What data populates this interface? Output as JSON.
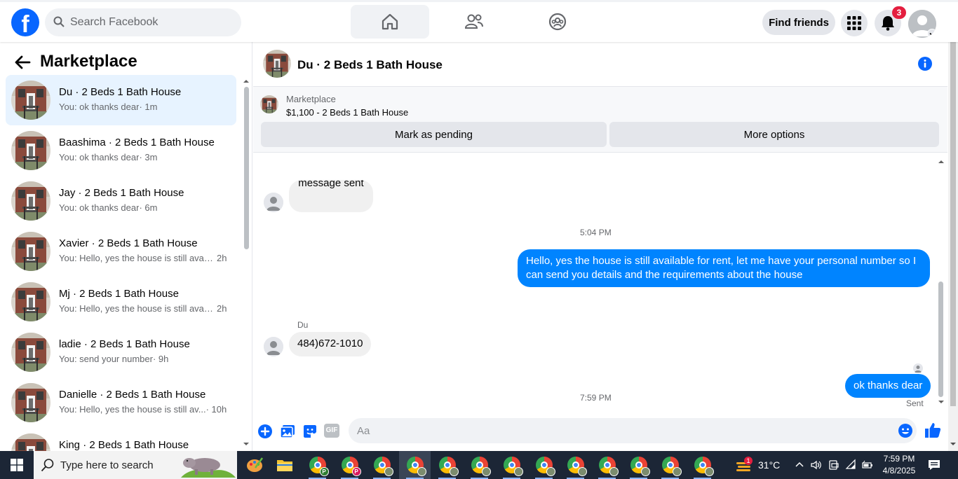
{
  "topbar": {
    "logo": "f",
    "search_placeholder": "Search Facebook",
    "find_friends": "Find friends",
    "notification_count": "3"
  },
  "sidebar": {
    "title": "Marketplace",
    "conversations": [
      {
        "name": "Du · 2 Beds 1 Bath House",
        "preview": "You: ok thanks dear",
        "time": "· 1m",
        "active": true
      },
      {
        "name": "Baashima · 2 Beds 1 Bath House",
        "preview": "You: ok thanks dear",
        "time": "· 3m"
      },
      {
        "name": "Jay · 2 Beds 1 Bath House",
        "preview": "You: ok thanks dear",
        "time": "· 6m"
      },
      {
        "name": "Xavier · 2 Beds 1 Bath House",
        "preview": "You: Hello, yes the house is still avai...",
        "time": "2h"
      },
      {
        "name": "Mj · 2 Beds 1 Bath House",
        "preview": "You: Hello, yes the house is still avai...",
        "time": "2h"
      },
      {
        "name": "ladie · 2 Beds 1 Bath House",
        "preview": "You: send your number",
        "time": "· 9h"
      },
      {
        "name": "Danielle · 2 Beds 1 Bath House",
        "preview": "You: Hello, yes the house is still av...",
        "time": "· 10h"
      },
      {
        "name": "King · 2 Beds 1 Bath House",
        "preview": "",
        "time": ""
      }
    ]
  },
  "chat": {
    "title": "Du · 2 Beds 1 Bath House",
    "marketplace_label": "Marketplace",
    "listing": "$1,100 - 2 Beds 1 Bath House",
    "mark_pending": "Mark as pending",
    "more_options": "More options",
    "partial_message": "message sent",
    "time1": "5:04 PM",
    "outgoing1": "Hello, yes the house is still available for rent, let me have your personal number so I can send you details and the requirements about the house",
    "sender": "Du",
    "incoming1": "484)672-1010",
    "time2": "7:59 PM",
    "outgoing2": "ok thanks dear",
    "sent_status": "Sent",
    "composer_placeholder": "Aa",
    "gif_label": "GIF"
  },
  "taskbar": {
    "search_placeholder": "Type here to search",
    "weather_badge": "1",
    "temperature": "31°C",
    "time": "7:59 PM",
    "date": "4/8/2025"
  },
  "colors": {
    "brand": "#0866ff",
    "outgoing_bubble": "#0084ff",
    "active_conversation": "#e7f3ff",
    "badge": "#e41e3f",
    "taskbar": "#1c2636"
  }
}
